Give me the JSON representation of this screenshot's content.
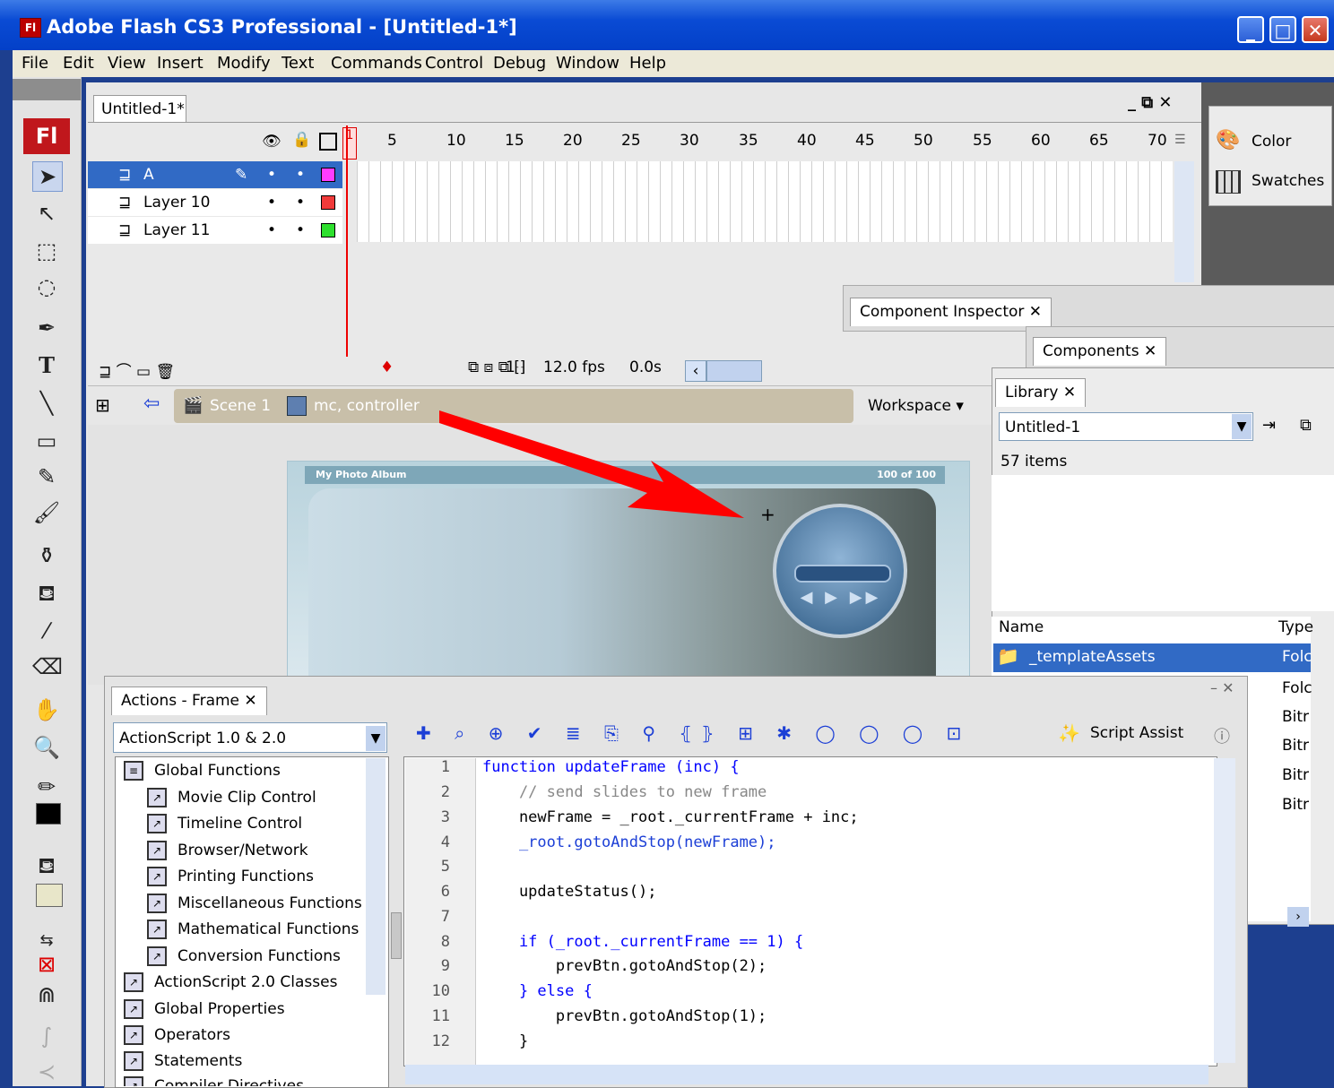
{
  "window": {
    "app_icon": "Fl",
    "title": "Adobe Flash CS3 Professional - [Untitled-1*]",
    "minimize": "_",
    "maximize": "□",
    "close": "✕"
  },
  "menu": [
    "File",
    "Edit",
    "View",
    "Insert",
    "Modify",
    "Text",
    "Commands",
    "Control",
    "Debug",
    "Window",
    "Help"
  ],
  "tools": {
    "logo": "Fl"
  },
  "document": {
    "tab": "Untitled-1*"
  },
  "timeline": {
    "ruler": [
      "1",
      "5",
      "10",
      "15",
      "20",
      "25",
      "30",
      "35",
      "40",
      "45",
      "50",
      "55",
      "60",
      "65",
      "70"
    ],
    "layers": [
      {
        "name": "A",
        "color": "#ff3cff",
        "selected": true
      },
      {
        "name": "Layer 10",
        "color": "#f03a3a",
        "selected": false
      },
      {
        "name": "Layer 11",
        "color": "#2ee02e",
        "selected": false
      }
    ],
    "current_frame": "1",
    "fps": "12.0 fps",
    "time": "0.0s"
  },
  "editbar": {
    "scene": "Scene 1",
    "symbol": "mc, controller",
    "workspace": "Workspace ▾"
  },
  "stage": {
    "album_title": "My Photo Album",
    "counter": "100 of 100"
  },
  "panels": {
    "color": "Color",
    "swatches": "Swatches",
    "component_inspector": "Component Inspector",
    "components": "Components",
    "library": {
      "tab": "Library",
      "document": "Untitled-1",
      "count": "57 items",
      "col_name": "Name",
      "col_type": "Type",
      "selected_item": "_templateAssets",
      "types": [
        "Folc",
        "Folc",
        "Bitr",
        "Bitr",
        "Bitr",
        "Bitr"
      ]
    }
  },
  "actions": {
    "tab": "Actions - Frame",
    "version": "ActionScript 1.0 & 2.0",
    "script_assist": "Script Assist",
    "tree": [
      {
        "label": "Global Functions",
        "level": 0
      },
      {
        "label": "Movie Clip Control",
        "level": 1
      },
      {
        "label": "Timeline Control",
        "level": 1
      },
      {
        "label": "Browser/Network",
        "level": 1
      },
      {
        "label": "Printing Functions",
        "level": 1
      },
      {
        "label": "Miscellaneous Functions",
        "level": 1
      },
      {
        "label": "Mathematical Functions",
        "level": 1
      },
      {
        "label": "Conversion Functions",
        "level": 1
      },
      {
        "label": "ActionScript 2.0 Classes",
        "level": 0
      },
      {
        "label": "Global Properties",
        "level": 0
      },
      {
        "label": "Operators",
        "level": 0
      },
      {
        "label": "Statements",
        "level": 0
      },
      {
        "label": "Compiler Directives",
        "level": 0
      }
    ],
    "code": [
      "function updateFrame (inc) {",
      "    // send slides to new frame",
      "    newFrame = _root._currentFrame + inc;",
      "    _root.gotoAndStop(newFrame);",
      "",
      "    updateStatus();",
      "",
      "    if (_root._currentFrame == 1) {",
      "        prevBtn.gotoAndStop(2);",
      "    } else {",
      "        prevBtn.gotoAndStop(1);",
      "    }"
    ],
    "line_numbers": [
      "1",
      "2",
      "3",
      "4",
      "5",
      "6",
      "7",
      "8",
      "9",
      "10",
      "11",
      "12"
    ]
  }
}
